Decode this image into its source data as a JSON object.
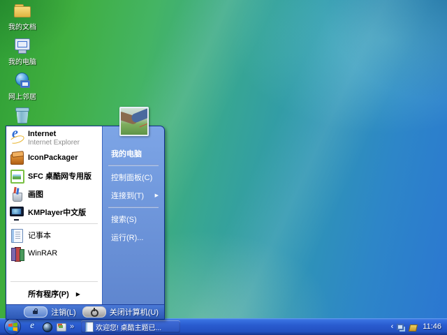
{
  "desktop": {
    "icons": [
      {
        "label": "我的文档",
        "icon": "my-documents"
      },
      {
        "label": "我的电脑",
        "icon": "my-computer"
      },
      {
        "label": "网上邻居",
        "icon": "network-places"
      },
      {
        "label": "",
        "icon": "recycle-bin"
      }
    ]
  },
  "start_menu": {
    "left_items": [
      {
        "title": "Internet",
        "subtitle": "Internet Explorer",
        "icon": "internet-explorer"
      },
      {
        "title": "IconPackager",
        "icon": "iconpackager"
      },
      {
        "title": "SFC 桌酷网专用版",
        "icon": "sfc"
      },
      {
        "title": "画图",
        "icon": "paint"
      },
      {
        "title": "KMPlayer中文版",
        "icon": "kmplayer"
      },
      {
        "title": "记事本",
        "icon": "notepad"
      },
      {
        "title": "WinRAR",
        "icon": "winrar"
      }
    ],
    "all_programs_label": "所有程序(P)",
    "right_items": [
      {
        "label": "我的电脑",
        "bold": true
      },
      {
        "label": "控制面板(C)"
      },
      {
        "label": "连接到(T)",
        "has_submenu": true
      },
      {
        "label": "搜索(S)"
      },
      {
        "label": "运行(R)..."
      }
    ],
    "logoff_label": "注销(L)",
    "shutdown_label": "关闭计算机(U)"
  },
  "taskbar": {
    "window_button": {
      "label": "欢迎您! 桌酷主题已...",
      "icon": "notepad"
    },
    "clock": "11:46"
  },
  "icons_glyphs": {
    "triangle_right": "▶",
    "overflow_chevron": "»",
    "tray_chevron": "‹"
  },
  "colors": {
    "taskbar_blue": "#2a5cd0",
    "menu_right_blue": "#6a93d6",
    "menu_bottom_blue": "#3a66c4",
    "wallpaper_green": "#3fae3f",
    "wallpaper_teal": "#2f97b2",
    "wallpaper_blue": "#2b76d2",
    "selection_text": "#ffffff"
  }
}
